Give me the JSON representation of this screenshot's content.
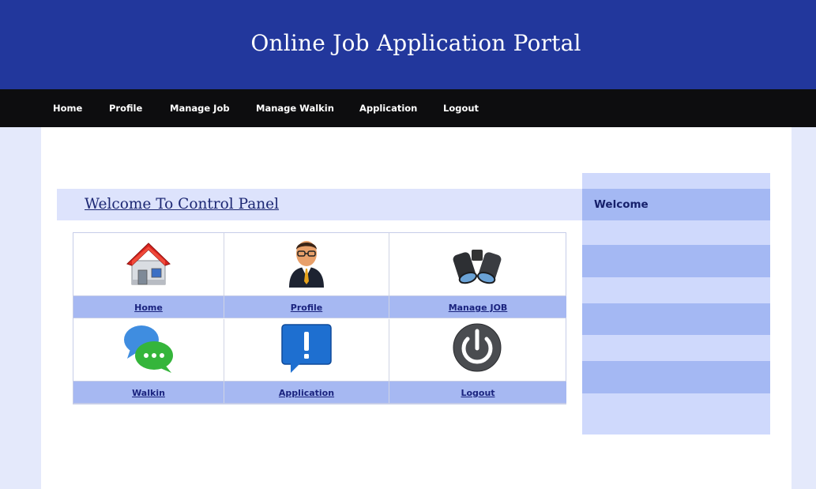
{
  "header": {
    "title": "Online Job Application Portal"
  },
  "nav": {
    "items": [
      {
        "label": "Home"
      },
      {
        "label": "Profile"
      },
      {
        "label": "Manage Job"
      },
      {
        "label": "Manage Walkin"
      },
      {
        "label": "Application"
      },
      {
        "label": "Logout"
      }
    ]
  },
  "main": {
    "title": "Welcome To Control Panel",
    "tiles": [
      {
        "label": "Home",
        "icon": "house-icon"
      },
      {
        "label": "Profile",
        "icon": "businessman-icon"
      },
      {
        "label": "Manage JOB",
        "icon": "binoculars-icon"
      },
      {
        "label": "Walkin",
        "icon": "chat-bubbles-icon"
      },
      {
        "label": "Application",
        "icon": "exclamation-bubble-icon"
      },
      {
        "label": "Logout",
        "icon": "power-icon"
      }
    ]
  },
  "sidebar": {
    "title": "Welcome"
  },
  "colors": {
    "header_bg": "#22379c",
    "nav_bg": "#0d0d0f",
    "tile_label_bg": "#a6b8f2",
    "sidebar_bg": "#cfd9fc",
    "link": "#1a237e"
  }
}
